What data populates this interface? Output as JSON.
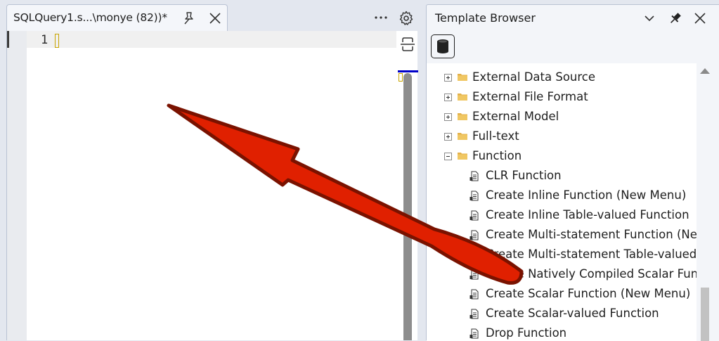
{
  "editor": {
    "tab_title": "SQLQuery1.s...\\monye (82))*",
    "line_number": "1"
  },
  "template_browser": {
    "title": "Template Browser",
    "tree": [
      {
        "label": "External Data Source",
        "kind": "folder",
        "expanded": false
      },
      {
        "label": "External File Format",
        "kind": "folder",
        "expanded": false
      },
      {
        "label": "External Model",
        "kind": "folder",
        "expanded": false
      },
      {
        "label": "Full-text",
        "kind": "folder",
        "expanded": false
      },
      {
        "label": "Function",
        "kind": "folder",
        "expanded": true
      },
      {
        "label": "CLR Function",
        "kind": "template"
      },
      {
        "label": "Create Inline Function (New Menu)",
        "kind": "template"
      },
      {
        "label": "Create Inline Table-valued Function",
        "kind": "template"
      },
      {
        "label": "Create Multi-statement Function (New",
        "kind": "template"
      },
      {
        "label": "Create Multi-statement Table-valued F",
        "kind": "template"
      },
      {
        "label": "Create Natively Compiled Scalar Funct",
        "kind": "template"
      },
      {
        "label": "Create Scalar Function (New Menu)",
        "kind": "template"
      },
      {
        "label": "Create Scalar-valued Function",
        "kind": "template"
      },
      {
        "label": "Drop Function",
        "kind": "template"
      }
    ]
  },
  "annotation": {
    "arrow_fill": "#e02000",
    "arrow_stroke": "#7a1200"
  }
}
